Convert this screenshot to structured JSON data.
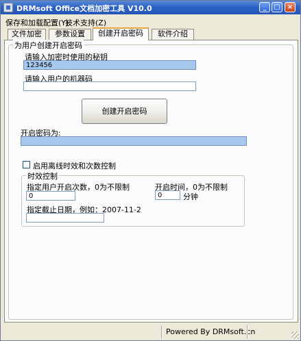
{
  "window": {
    "title": "DRMsoft Office文档加密工具 V10.0",
    "controls": {
      "minimize": "_",
      "maximize": "□",
      "close": "×"
    }
  },
  "menu": {
    "items": [
      "保存和加载配置(Y)",
      "技术支持(Z)"
    ]
  },
  "tabs": [
    {
      "label": "文件加密",
      "active": false
    },
    {
      "label": "参数设置",
      "active": false
    },
    {
      "label": "创建开启密码",
      "active": true
    },
    {
      "label": "软件介绍",
      "active": false
    }
  ],
  "panel": {
    "group_title": "为用户创建开启密码",
    "secret_key": {
      "label": "请输入加密时使用的秘钥",
      "value": "123456"
    },
    "machine_code": {
      "label": "请输入用户的机器码",
      "value": ""
    },
    "create_button": "创建开启密码",
    "open_password": {
      "label": "开启密码为:",
      "value": ""
    },
    "offline_checkbox": {
      "label": "启用离线时效和次数控制",
      "checked": false
    },
    "time_group": {
      "title": "时效控制",
      "open_count": {
        "label": "指定用户开启次数，0为不限制",
        "value": "0"
      },
      "open_time": {
        "label": "开启时间，0为不限制",
        "value": "0",
        "unit": "分钟"
      },
      "expiry_date": {
        "label": "指定截止日期，例如：2007-11-2",
        "value": ""
      }
    }
  },
  "status": {
    "text": "Powered By DRMsoft.cn"
  },
  "colors": {
    "titlebar": "#2c62c4",
    "window_bg": "#ece9d8",
    "field_highlight": "#a6c8ec",
    "active_tab_accent": "#e8a63a"
  }
}
